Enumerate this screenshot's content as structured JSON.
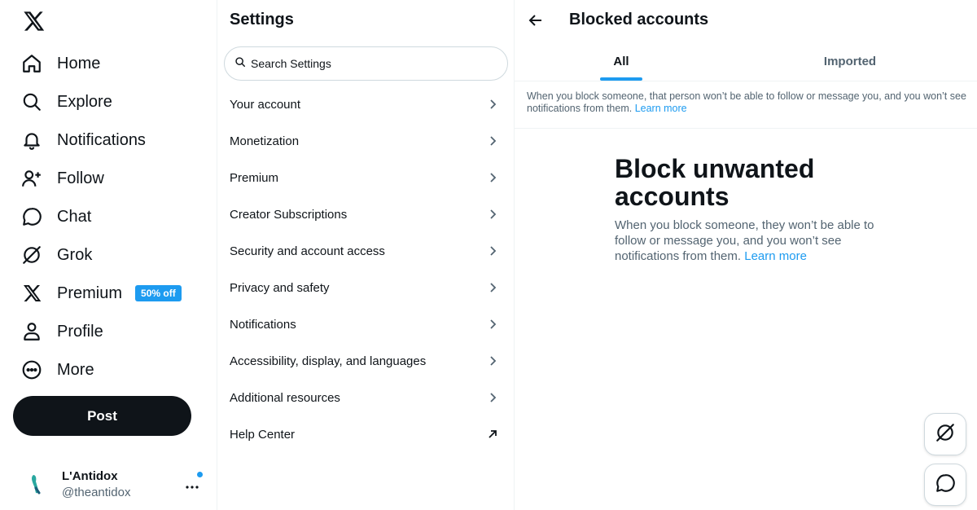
{
  "nav": {
    "items": [
      {
        "label": "Home"
      },
      {
        "label": "Explore"
      },
      {
        "label": "Notifications"
      },
      {
        "label": "Follow"
      },
      {
        "label": "Chat"
      },
      {
        "label": "Grok"
      },
      {
        "label": "Premium",
        "badge": "50% off"
      },
      {
        "label": "Profile"
      },
      {
        "label": "More"
      }
    ],
    "post_label": "Post",
    "account": {
      "name": "L'Antidox",
      "handle": "@theantidox"
    }
  },
  "settings": {
    "title": "Settings",
    "search_placeholder": "Search Settings",
    "items": [
      {
        "label": "Your account"
      },
      {
        "label": "Monetization"
      },
      {
        "label": "Premium"
      },
      {
        "label": "Creator Subscriptions"
      },
      {
        "label": "Security and account access"
      },
      {
        "label": "Privacy and safety"
      },
      {
        "label": "Notifications"
      },
      {
        "label": "Accessibility, display, and languages"
      },
      {
        "label": "Additional resources"
      },
      {
        "label": "Help Center"
      }
    ]
  },
  "main": {
    "title": "Blocked accounts",
    "tabs": [
      {
        "label": "All"
      },
      {
        "label": "Imported"
      }
    ],
    "info_text": "When you block someone, that person won’t be able to follow or message you, and you won’t see notifications from them.",
    "info_link": "Learn more",
    "empty_title": "Block unwanted accounts",
    "empty_desc": "When you block someone, they won’t be able to follow or message you, and you won’t see notifications from them.",
    "empty_link": "Learn more"
  },
  "colors": {
    "accent": "#1d9bf0",
    "text": "#0f1419",
    "muted": "#536471",
    "border": "#eff3f4"
  }
}
